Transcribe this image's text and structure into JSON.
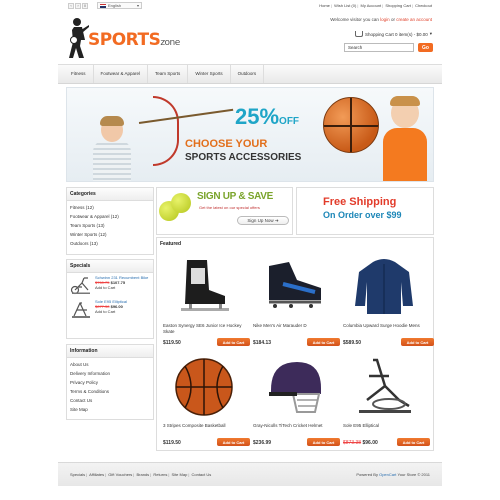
{
  "topbar": {
    "language": "English",
    "links": [
      "Home",
      "Wish List (0)",
      "My Account",
      "Shopping Cart",
      "Checkout"
    ]
  },
  "header": {
    "logo_main": "SPORTS",
    "logo_sub": "zone",
    "welcome_prefix": "Welcome visitor you can",
    "login": "login",
    "welcome_or": "or",
    "create_account": "create an account",
    "cart_text": "Shopping Cart 0 item(s) - $0.00",
    "search_value": "Search",
    "go_label": "Go"
  },
  "nav": [
    "Fitness",
    "Footwear & Apparel",
    "Team Sports",
    "Winter Sports",
    "Outdoors"
  ],
  "banner": {
    "percent": "25%",
    "off": "OFF",
    "line1": "CHOOSE YOUR",
    "line2": "SPORTS ACCESSORIES"
  },
  "categories": {
    "title": "Categories",
    "items": [
      "Fitness (12)",
      "Footwear & Apparel (12)",
      "Team Sports (13)",
      "Winter Sports (12)",
      "Outdoors (13)"
    ]
  },
  "specials": {
    "title": "Specials",
    "items": [
      {
        "name": "Schwinn 231 Recumbent Bike",
        "old": "$760.75",
        "new": "$107.75",
        "add": "Add to Cart"
      },
      {
        "name": "Sole E95 Elliptical",
        "old": "$877.38",
        "new": "$96.00",
        "add": "Add to Cart"
      }
    ]
  },
  "information": {
    "title": "Information",
    "items": [
      "About Us",
      "Delivery Information",
      "Privacy Policy",
      "Terms & Conditions",
      "Contact Us",
      "Site Map"
    ]
  },
  "promo_signup": {
    "title": "SIGN UP & SAVE",
    "subtitle": "Get the latest on our special offers",
    "button": "Sign Up Now"
  },
  "promo_shipping": {
    "title": "Free Shipping",
    "subtitle": "On Order over $99"
  },
  "featured": {
    "title": "Featured",
    "add_label": "Add to Cart",
    "products": [
      {
        "name": "Easton Synergy SE6 Junior Ice Hockey Skate",
        "price": "$119.50",
        "old": ""
      },
      {
        "name": "Nike Men's Air Marauder D",
        "price": "$184.13",
        "old": ""
      },
      {
        "name": "Columbia Upward Surge Hoodie Mens",
        "price": "$589.50",
        "old": ""
      },
      {
        "name": "3 Stripes Composite Basketball",
        "price": "$119.50",
        "old": ""
      },
      {
        "name": "Gray-Nicolls TiTech Cricket Helmet",
        "price": "$236.99",
        "old": ""
      },
      {
        "name": "Sole E95 Elliptical",
        "price": "$96.00",
        "old": "$873.38"
      }
    ]
  },
  "footer": {
    "links": [
      "Specials",
      "Affiliates",
      "Gift Vouchers",
      "Brands",
      "Returns",
      "Site Map",
      "Contact Us"
    ],
    "powered_prefix": "Powered By",
    "powered_link": "OpenCart",
    "powered_suffix": "Your Store © 2011"
  }
}
